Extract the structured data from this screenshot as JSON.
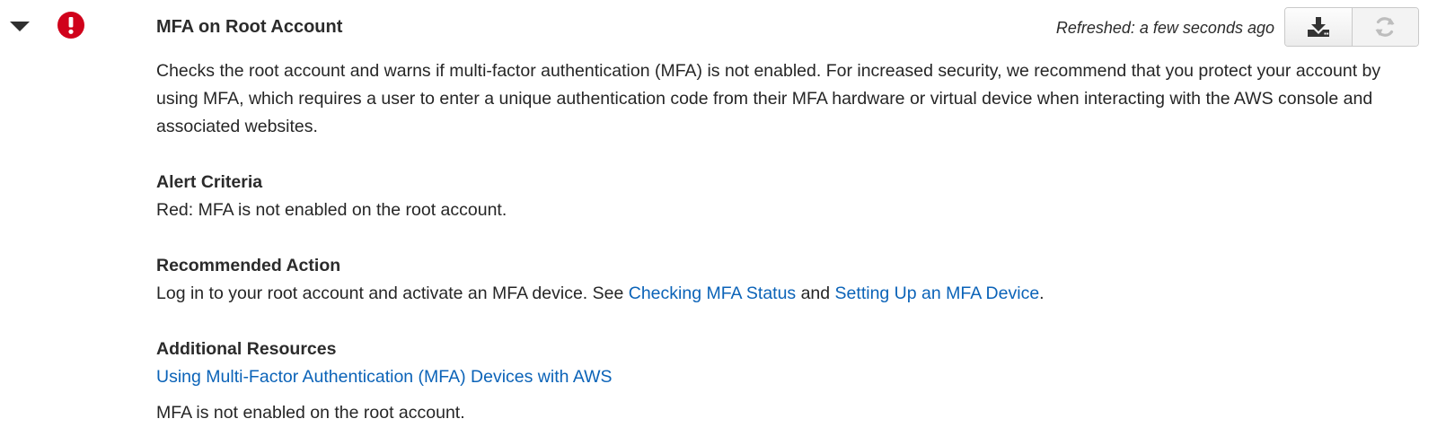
{
  "check": {
    "title": "MFA on Root Account",
    "status_color": "#d0021b",
    "refreshed": "Refreshed: a few seconds ago",
    "description": "Checks the root account and warns if multi-factor authentication (MFA) is not enabled. For increased security, we recommend that you protect your account by using MFA, which requires a user to enter a unique authentication code from their MFA hardware or virtual device when interacting with the AWS console and associated websites."
  },
  "toolbar": {
    "download_icon": "download-icon",
    "refresh_icon": "refresh-icon"
  },
  "alert_criteria": {
    "title": "Alert Criteria",
    "text": "Red: MFA is not enabled on the root account."
  },
  "recommended_action": {
    "title": "Recommended Action",
    "text_before": "Log in to your root account and activate an MFA device. See ",
    "link1": "Checking MFA Status",
    "text_between": " and ",
    "link2": "Setting Up an MFA Device",
    "text_after": "."
  },
  "additional_resources": {
    "title": "Additional Resources",
    "link": "Using Multi-Factor Authentication (MFA) Devices with AWS"
  },
  "result_text": "MFA is not enabled on the root account.",
  "colors": {
    "link": "#0b63b8",
    "error": "#d0021b"
  }
}
